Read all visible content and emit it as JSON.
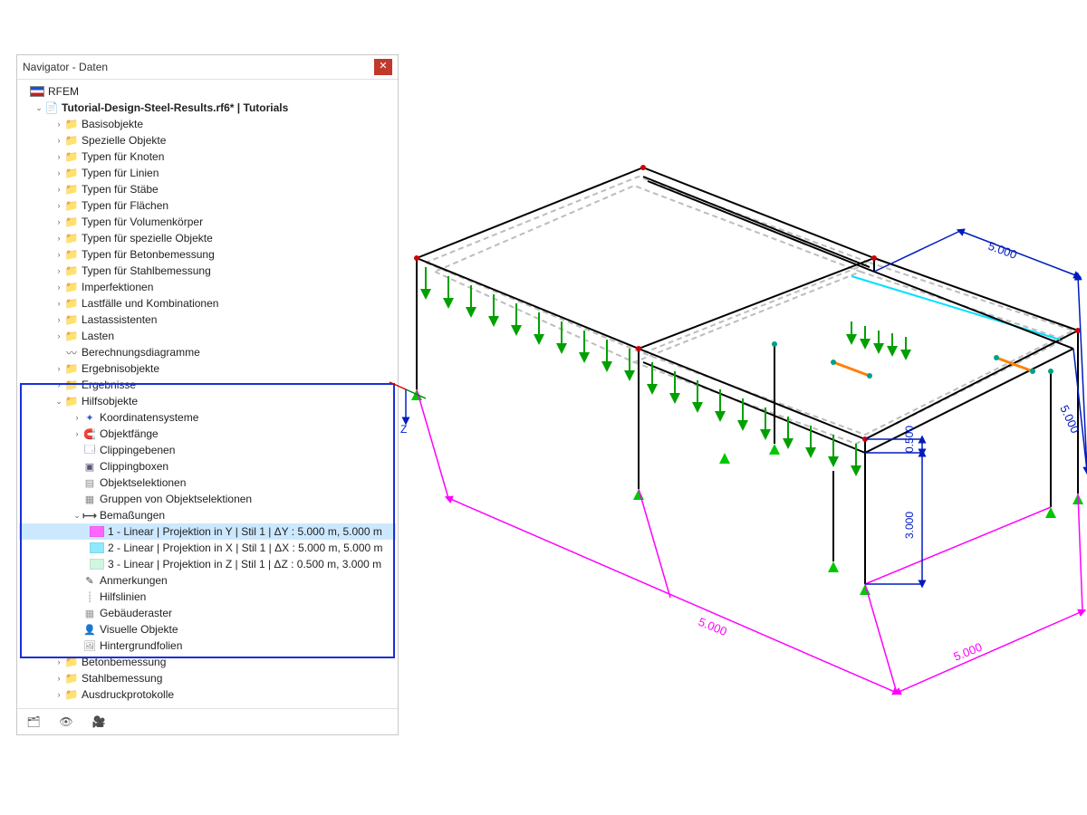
{
  "panel": {
    "title": "Navigator - Daten",
    "app_label": "RFEM",
    "file_label": "Tutorial-Design-Steel-Results.rf6* | Tutorials",
    "level2": {
      "basisobjekte": "Basisobjekte",
      "spezielle": "Spezielle Objekte",
      "typ_knoten": "Typen für Knoten",
      "typ_linien": "Typen für Linien",
      "typ_staebe": "Typen für Stäbe",
      "typ_flaechen": "Typen für Flächen",
      "typ_volumen": "Typen für Volumenkörper",
      "typ_spezielle": "Typen für spezielle Objekte",
      "typ_beton": "Typen für Betonbemessung",
      "typ_stahl": "Typen für Stahlbemessung",
      "imperfekt": "Imperfektionen",
      "lastfaelle": "Lastfälle und Kombinationen",
      "lastassist": "Lastassistenten",
      "lasten": "Lasten",
      "berechnung": "Berechnungsdiagramme",
      "ergobj": "Ergebnisobjekte",
      "erg": "Ergebnisse",
      "hilfs": "Hilfsobjekte",
      "beton": "Betonbemessung",
      "stahl": "Stahlbemessung",
      "ausdruck": "Ausdruckprotokolle"
    },
    "hilfs_children": {
      "koord": "Koordinatensysteme",
      "objfaenge": "Objektfänge",
      "clipebenen": "Clippingebenen",
      "clipboxen": "Clippingboxen",
      "objsel": "Objektselektionen",
      "gruppen": "Gruppen von Objektselektionen",
      "bemassungen": "Bemaßungen",
      "anmerk": "Anmerkungen",
      "hilfslinien": "Hilfslinien",
      "gebraster": "Gebäuderaster",
      "visobj": "Visuelle Objekte",
      "hintergrund": "Hintergrundfolien"
    },
    "dimensions": {
      "d1": {
        "label": "1 - Linear | Projektion in Y | Stil 1 | ΔY : 5.000 m, 5.000 m",
        "color": "#ff00ff"
      },
      "d2": {
        "label": "2 - Linear | Projektion in X | Stil 1 | ΔX : 5.000 m, 5.000 m",
        "color": "#001bbf"
      },
      "d3": {
        "label": "3 - Linear | Projektion in Z | Stil 1 | ΔZ : 0.500 m, 3.000 m",
        "color": "#001bbf"
      }
    }
  },
  "viewport": {
    "dim_values": {
      "v500a": "5.000",
      "v500b": "5.000",
      "v500c": "5.000",
      "v500d": "5.000",
      "v050": "0.500",
      "v300": "3.000"
    },
    "axis_z": "Z"
  }
}
